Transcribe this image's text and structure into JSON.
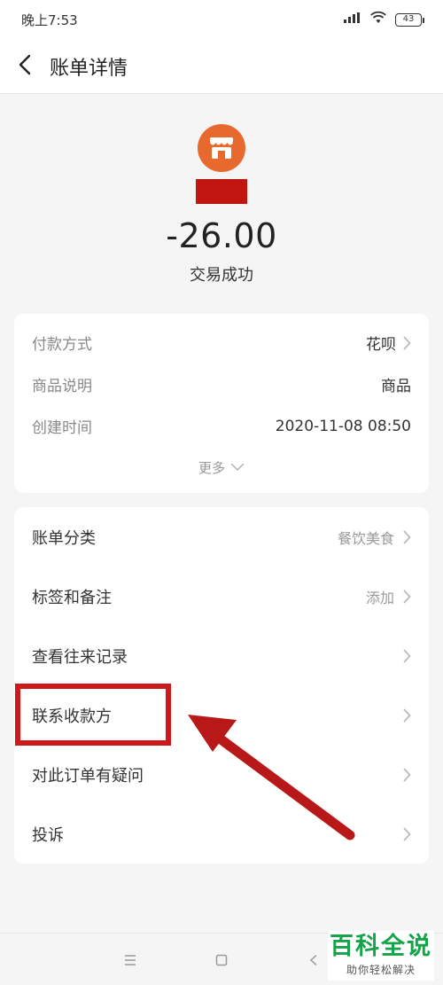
{
  "status_bar": {
    "time": "晚上7:53",
    "battery": "43"
  },
  "header": {
    "title": "账单详情"
  },
  "merchant": {
    "amount": "-26.00",
    "status": "交易成功"
  },
  "details": {
    "rows": [
      {
        "label": "付款方式",
        "value": "花呗"
      },
      {
        "label": "商品说明",
        "value": "商品"
      },
      {
        "label": "创建时间",
        "value": "2020-11-08 08:50"
      }
    ],
    "more_label": "更多"
  },
  "actions": {
    "items": [
      {
        "label": "账单分类",
        "value": "餐饮美食"
      },
      {
        "label": "标签和备注",
        "value": "添加"
      },
      {
        "label": "查看往来记录",
        "value": ""
      },
      {
        "label": "联系收款方",
        "value": ""
      },
      {
        "label": "对此订单有疑问",
        "value": ""
      },
      {
        "label": "投诉",
        "value": ""
      }
    ]
  },
  "annotation": {
    "highlight_color": "#cc1a1a",
    "highlighted_item": "联系收款方"
  },
  "watermark": {
    "title": "百科全说",
    "subtitle": "助你轻松解决"
  },
  "colors": {
    "merchant_icon": "#e8692e",
    "redaction": "#c0160f",
    "watermark_green": "#16a34a"
  }
}
